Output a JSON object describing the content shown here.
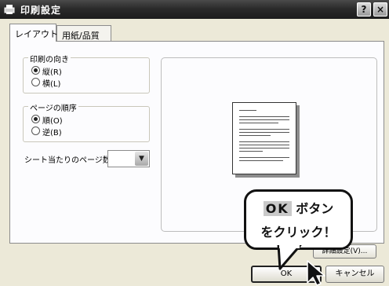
{
  "window": {
    "title": "印刷設定",
    "help_button": "?",
    "close_button": "×"
  },
  "tabs": [
    {
      "label": "レイアウト",
      "active": true
    },
    {
      "label": "用紙/品質",
      "active": false
    }
  ],
  "orientation_group": {
    "legend": "印刷の向き",
    "options": [
      {
        "label": "縦(R)",
        "selected": true
      },
      {
        "label": "横(L)",
        "selected": false
      }
    ]
  },
  "page_order_group": {
    "legend": "ページの順序",
    "options": [
      {
        "label": "順(O)",
        "selected": true
      },
      {
        "label": "逆(B)",
        "selected": false
      }
    ]
  },
  "pages_per_sheet": {
    "label": "シート当たりのページ数(S):",
    "value": ""
  },
  "advanced_button": "詳細設定(V)...",
  "ok_button": "OK",
  "cancel_button": "キャンセル",
  "callout": {
    "highlight": "OK",
    "line1_rest": " ボタン",
    "line2": "をクリック！"
  }
}
